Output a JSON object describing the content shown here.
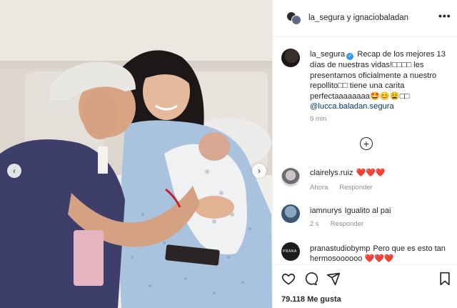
{
  "header": {
    "names": "la_segura y ignaciobaladan",
    "more_icon": "more-horizontal-icon"
  },
  "post": {
    "author": "la_segura",
    "caption_text": "Recap de los mejores 13 días de nuestras vidas!⁣⁣⁣⁣ les presentamos oficialmente a nuestro repollito⁣⁣ tiene una carita perfectaaaaaaaa🤩😊😩⁣⁣",
    "caption_lines": [
      "Recap de los mejores 13",
      "días de nuestras vidas!□□□□ les",
      "presentamos oficialmente a nuestro",
      "repollito□□ tiene una carita",
      "perfectaaaaaaaa🤩😊😩□□"
    ],
    "mention": "@lucca.baladan.segura",
    "time": "9 min"
  },
  "comments": [
    {
      "user": "clairelys.ruiz",
      "text": "❤️❤️❤️",
      "time": "Ahora",
      "reply": "Responder"
    },
    {
      "user": "iamnurys",
      "text": "Igualito al pai",
      "time": "2 s",
      "reply": "Responder"
    },
    {
      "user": "pranastudiobymp",
      "text": "Pero que es esto tan hermosoooooo ❤️❤️❤️",
      "time": "",
      "reply": ""
    }
  ],
  "comment_avatar_badge": "PRANA",
  "actions": {
    "like_icon": "heart-icon",
    "comment_icon": "comment-icon",
    "share_icon": "send-icon",
    "save_icon": "bookmark-icon"
  },
  "likes": "79.118 Me gusta",
  "media_nav": {
    "prev_icon": "chevron-left-icon",
    "next_icon": "chevron-right-icon"
  },
  "colors": {
    "accent": "#3897f0",
    "heart": "#ed4956",
    "muted": "#8e8e8e",
    "link": "#00376b"
  }
}
